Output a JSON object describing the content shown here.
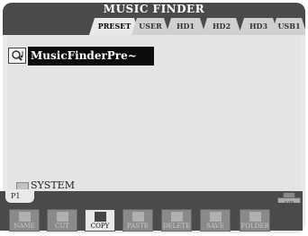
{
  "title": "MUSIC FINDER",
  "tabs": [
    {
      "label": "PRESET",
      "active": true
    },
    {
      "label": "USER",
      "active": false
    },
    {
      "label": "HD1",
      "active": false
    },
    {
      "label": "HD2",
      "active": false
    },
    {
      "label": "HD3",
      "active": false
    },
    {
      "label": "USB1",
      "active": false
    }
  ],
  "current_file": "MusicFinderPre~",
  "search_icon": "magnifier-note-icon",
  "folders": [
    {
      "label": "SYSTEM",
      "icon": "folder-icon"
    }
  ],
  "page_tab": "P1",
  "up_button": {
    "label": "UP",
    "icon": "up-folder-icon"
  },
  "function_buttons": [
    {
      "label": "NAME",
      "icon": "name-icon",
      "enabled": false
    },
    {
      "label": "CUT",
      "icon": "scissors-icon",
      "enabled": false
    },
    {
      "label": "COPY",
      "icon": "copy-icon",
      "enabled": true
    },
    {
      "label": "PASTE",
      "icon": "paste-icon",
      "enabled": false
    },
    {
      "label": "DELETE",
      "icon": "trash-icon",
      "enabled": false
    },
    {
      "label": "SAVE",
      "icon": "save-icon",
      "enabled": false
    },
    {
      "label": "FOLDER",
      "icon": "folder-icon",
      "enabled": false
    }
  ]
}
